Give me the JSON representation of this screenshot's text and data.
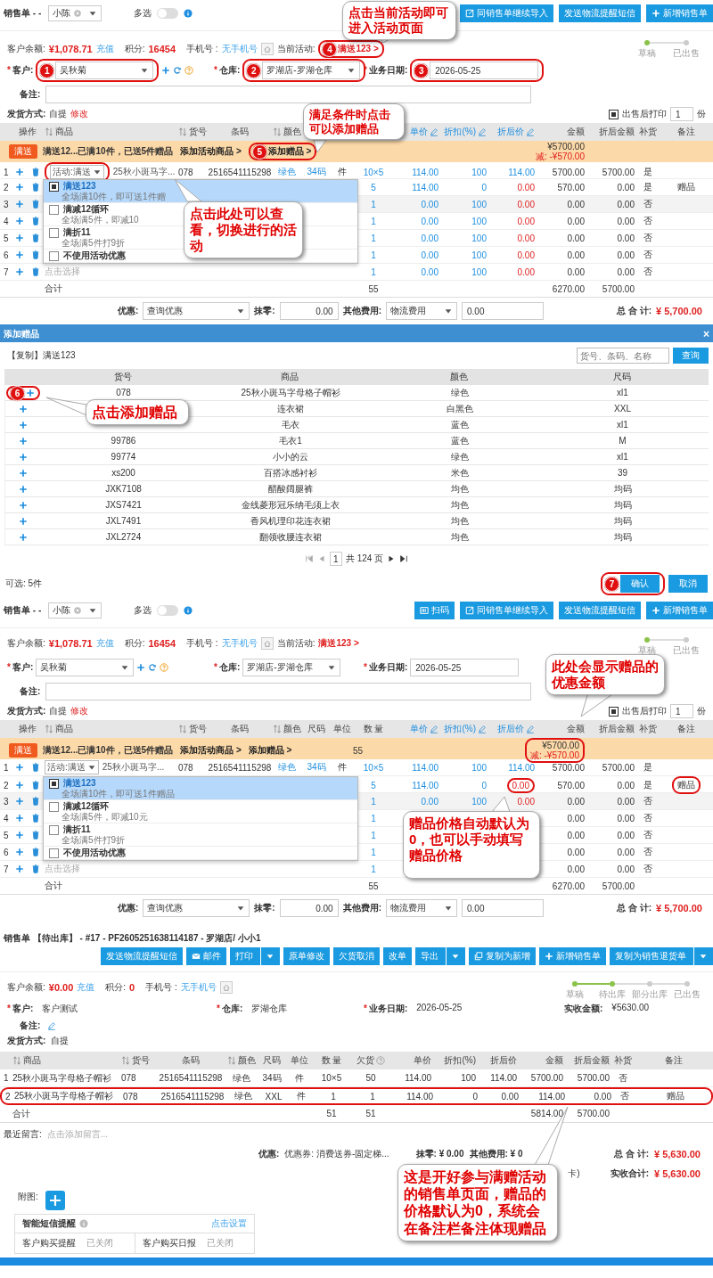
{
  "order_edit_1": {
    "toolbar": {
      "title": "销售单 - -",
      "salesperson": "小陈",
      "multi_select": "多选",
      "multi_select_on": false,
      "buttons": [
        {
          "label": "同销售单继续导入",
          "kind": "import"
        },
        {
          "label": "发送物流提醒短信",
          "kind": "plain"
        },
        {
          "label": "新增销售单",
          "kind": "plus"
        }
      ]
    },
    "info": {
      "balance_label": "客户余额:",
      "balance": "¥1,078.71",
      "recharge": "充值",
      "points_label": "积分:",
      "points": "16454",
      "phone_label": "手机号 :",
      "phone": "无手机号",
      "activity_label": "当前活动:",
      "activity": "满送123 >",
      "activity_marker": "4"
    },
    "steps": [
      {
        "label": "草稿",
        "done": true
      },
      {
        "label": "已出售",
        "done": false
      }
    ],
    "form": [
      {
        "mark": "*",
        "label": "客户:",
        "value": "吴秋菊",
        "kind": "customer",
        "marker": "1"
      },
      {
        "mark": "*",
        "label": "仓库:",
        "value": "罗湖店-罗湖仓库",
        "kind": "select",
        "marker": "2"
      },
      {
        "mark": "*",
        "label": "业务日期:",
        "value": "2026-05-25",
        "kind": "text",
        "marker": "3"
      }
    ],
    "note_label": "备注:",
    "delivery": {
      "label": "发货方式:",
      "value": "自提",
      "action": "修改",
      "print_label": "出售后打印",
      "print_checked": true,
      "copies": "1",
      "copies_unit": "份"
    },
    "columns": [
      {
        "label": "操作",
        "sortable": false,
        "editable": false
      },
      {
        "label": "商品",
        "sortable": true,
        "editable": false
      },
      {
        "label": "货号",
        "sortable": true,
        "editable": false
      },
      {
        "label": "条码",
        "sortable": false,
        "editable": false
      },
      {
        "label": "颜色",
        "sortable": true,
        "editable": false
      },
      {},
      {},
      {},
      {
        "label": "单价",
        "sortable": false,
        "editable": true
      },
      {
        "label": "折扣(%)",
        "sortable": false,
        "editable": true
      },
      {
        "label": "折后价",
        "sortable": false,
        "editable": true
      },
      {
        "label": "金额",
        "sortable": false,
        "editable": false
      },
      {
        "label": "折后金额",
        "sortable": false,
        "editable": false
      },
      {
        "label": "补货",
        "sortable": false,
        "editable": false
      },
      {
        "label": "备注",
        "sortable": false,
        "editable": false
      }
    ],
    "banner": {
      "badge": "满送",
      "text": "满送12...已满10件，已送5件赠品",
      "links": [
        {
          "label": "添加活动商品 >"
        },
        {
          "label": "添加赠品 >",
          "marker": "5"
        }
      ],
      "amount": "¥5700.00",
      "discount": "减: -¥570.00",
      "amount_ringed": false
    },
    "rows": [
      {
        "index": "1",
        "select": "活动:满送",
        "select_ringed": true,
        "hovered": false,
        "zero_price": false,
        "cells": [
          null,
          "25秋小斑马字...",
          "078",
          "2516541115298",
          "绿色",
          "34码",
          "件",
          "10×5",
          "114.00",
          "100",
          "114.00",
          "5700.00",
          "5700.00",
          "是",
          null
        ]
      },
      {
        "index": "2",
        "hovered": false,
        "zero_price": true,
        "cells": [
          null,
          null,
          null,
          null,
          null,
          null,
          null,
          "5",
          "114.00",
          "0",
          "0.00",
          "570.00",
          "0.00",
          "是",
          "赠品"
        ]
      },
      {
        "index": "3",
        "hovered": true,
        "zero_price": true,
        "cells": [
          null,
          null,
          null,
          null,
          null,
          null,
          null,
          "1",
          "0.00",
          "100",
          "0.00",
          "0.00",
          "0.00",
          "否",
          null
        ]
      },
      {
        "index": "4",
        "hovered": false,
        "zero_price": true,
        "cells": [
          null,
          null,
          null,
          null,
          null,
          null,
          null,
          "1",
          "0.00",
          "100",
          "0.00",
          "0.00",
          "0.00",
          "否",
          null
        ]
      },
      {
        "index": "5",
        "hovered": false,
        "zero_price": true,
        "cells": [
          null,
          null,
          null,
          null,
          null,
          null,
          null,
          "1",
          "0.00",
          "100",
          "0.00",
          "0.00",
          "0.00",
          "否",
          null
        ]
      },
      {
        "index": "6",
        "hovered": false,
        "zero_price": true,
        "cells": [
          null,
          null,
          null,
          null,
          null,
          null,
          null,
          "1",
          "0.00",
          "100",
          "0.00",
          "0.00",
          "0.00",
          "否",
          null
        ]
      },
      {
        "index": "7",
        "placeholder": "点击选择",
        "hovered": false,
        "zero_price": true,
        "cells": [
          null,
          null,
          null,
          null,
          null,
          null,
          null,
          "1",
          "0.00",
          "100",
          "0.00",
          "0.00",
          "0.00",
          "否",
          null
        ]
      }
    ],
    "total": {
      "label": "合计",
      "qty": "55",
      "amount": "6270.00",
      "net_amount": "5700.00"
    },
    "dropdown": [
      {
        "title": "满送123",
        "subtitle": "全场满10件，即可送1件赠",
        "checked": true,
        "selected": true
      },
      {
        "title": "满减12循环",
        "subtitle": "全场满5件，即减10",
        "checked": false,
        "selected": false
      },
      {
        "title": "满折11",
        "subtitle": "全场满5件打9折",
        "checked": false,
        "selected": false
      },
      {
        "title": "不使用活动优惠",
        "checked": false,
        "selected": false
      }
    ],
    "footer": {
      "discount_label": "优惠:",
      "discount_select": "查询优惠",
      "rounding_label": "抹零:",
      "rounding": "0.00",
      "other_label": "其他费用:",
      "other_select": "物流费用",
      "other": "0.00",
      "total_label": "总 合 计:",
      "total": "¥ 5,700.00"
    },
    "callouts": [
      {
        "text": "点击当前活动即可进入活动页面"
      },
      {
        "text": "满足条件时点击可以添加赠品"
      },
      {
        "text": "点击此处可以查看，切换进行的活动"
      }
    ]
  },
  "gift_dialog": {
    "title": "添加赠品",
    "close": "×",
    "activity": "【复制】满送123",
    "search_placeholder": "货号、条码、名称",
    "search_button": "查询",
    "columns": [
      "货号",
      "商品",
      "颜色",
      "尺码"
    ],
    "rows": [
      {
        "cells": [
          "078",
          "25秋小斑马字母格子帽衫",
          "绿色",
          "xl1"
        ],
        "marker": "6"
      },
      {
        "cells": [
          null,
          "连衣裙",
          "白黑色",
          "XXL"
        ]
      },
      {
        "cells": [
          null,
          "毛衣",
          "蓝色",
          "xl1"
        ]
      },
      {
        "cells": [
          "99786",
          "毛衣1",
          "蓝色",
          "M"
        ]
      },
      {
        "cells": [
          "99774",
          "小小的云",
          "绿色",
          "xl1"
        ]
      },
      {
        "cells": [
          "xs200",
          "百搭冰感衬衫",
          "米色",
          "39"
        ]
      },
      {
        "cells": [
          "JXK7108",
          "醋酸阔腿裤",
          "均色",
          "均码"
        ]
      },
      {
        "cells": [
          "JXS7421",
          "金线菱形冠乐纳毛须上衣",
          "均色",
          "均码"
        ]
      },
      {
        "cells": [
          "JXL7491",
          "香风机理印花连衣裙",
          "均色",
          "均码"
        ]
      },
      {
        "cells": [
          "JXL2724",
          "翻领收腰连衣裙",
          "均色",
          "均码"
        ]
      }
    ],
    "pagination": {
      "page": "1",
      "summary": "共 124 页"
    },
    "selected_count": "可选: 5件",
    "confirm": {
      "label": "确认",
      "marker": "7"
    },
    "cancel": "取消",
    "callouts": [
      {
        "text": "点击添加赠品"
      }
    ]
  },
  "order_edit_2": {
    "toolbar": {
      "title": "销售单 - -",
      "salesperson": "小陈",
      "multi_select": "多选",
      "multi_select_on": false,
      "buttons": [
        {
          "label": "扫码",
          "kind": "scan"
        },
        {
          "label": "同销售单继续导入",
          "kind": "import"
        },
        {
          "label": "发送物流提醒短信",
          "kind": "plain"
        },
        {
          "label": "新增销售单",
          "kind": "plus"
        }
      ]
    },
    "info": {
      "balance_label": "客户余额:",
      "balance": "¥1,078.71",
      "recharge": "充值",
      "points_label": "积分:",
      "points": "16454",
      "phone_label": "手机号 :",
      "phone": "无手机号",
      "activity_label": "当前活动:",
      "activity": "满送123 >"
    },
    "steps": [
      {
        "label": "草稿",
        "done": true
      },
      {
        "label": "已出售",
        "done": false
      }
    ],
    "form": [
      {
        "mark": "*",
        "label": "客户:",
        "value": "吴秋菊",
        "kind": "customer"
      },
      {
        "mark": "*",
        "label": "仓库:",
        "value": "罗湖店-罗湖仓库",
        "kind": "select"
      },
      {
        "mark": "*",
        "label": "业务日期:",
        "value": "2026-05-25",
        "kind": "text"
      }
    ],
    "note_label": "备注:",
    "delivery": {
      "label": "发货方式:",
      "value": "自提",
      "action": "修改",
      "print_label": "出售后打印",
      "print_checked": true,
      "copies": "1",
      "copies_unit": "份"
    },
    "columns": [
      {
        "label": "操作",
        "sortable": false,
        "editable": false
      },
      {
        "label": "商品",
        "sortable": true,
        "editable": false
      },
      {
        "label": "货号",
        "sortable": true,
        "editable": false
      },
      {
        "label": "条码",
        "sortable": false,
        "editable": false
      },
      {
        "label": "颜色",
        "sortable": true,
        "editable": false
      },
      {
        "label": "尺码",
        "sortable": false,
        "editable": false
      },
      {
        "label": "单位",
        "sortable": false,
        "editable": false
      },
      {
        "label": "数 量",
        "sortable": false,
        "editable": false
      },
      {
        "label": "单价",
        "sortable": false,
        "editable": true
      },
      {
        "label": "折扣(%)",
        "sortable": false,
        "editable": true
      },
      {
        "label": "折后价",
        "sortable": false,
        "editable": true
      },
      {
        "label": "金额",
        "sortable": false,
        "editable": false
      },
      {
        "label": "折后金额",
        "sortable": false,
        "editable": false
      },
      {
        "label": "补货",
        "sortable": false,
        "editable": false
      },
      {
        "label": "备注",
        "sortable": false,
        "editable": false
      }
    ],
    "banner": {
      "badge": "满送",
      "text": "满送12...已满10件，已送5件赠品",
      "links": [
        {
          "label": "添加活动商品 >"
        },
        {
          "label": "添加赠品 >"
        }
      ],
      "qty": "55",
      "amount": "¥5700.00",
      "discount": "减: -¥570.00",
      "amount_ringed": true
    },
    "rows": [
      {
        "index": "1",
        "select": "活动:满送",
        "select_ringed": false,
        "hovered": false,
        "zero_price": false,
        "cells": [
          null,
          "25秋小斑马字...",
          "078",
          "2516541115298",
          "绿色",
          "34码",
          "件",
          "10×5",
          "114.00",
          "100",
          "114.00",
          "5700.00",
          "5700.00",
          "是",
          null
        ]
      },
      {
        "index": "2",
        "hovered": false,
        "zero_price": true,
        "cells": [
          null,
          null,
          null,
          null,
          null,
          null,
          null,
          "5",
          "114.00",
          "0",
          {
            "text": "0.00",
            "ringed": true
          },
          "570.00",
          "0.00",
          "是",
          {
            "text": "赠品",
            "ringed": true
          }
        ]
      },
      {
        "index": "3",
        "hovered": true,
        "zero_price": true,
        "cells": [
          null,
          null,
          null,
          null,
          null,
          null,
          null,
          "1",
          "0.00",
          "100",
          "0.00",
          "0.00",
          "0.00",
          "否",
          null
        ]
      },
      {
        "index": "4",
        "hovered": false,
        "cells": [
          null,
          null,
          null,
          null,
          null,
          null,
          null,
          "1",
          null,
          null,
          null,
          "0.00",
          "0.00",
          "否",
          null
        ]
      },
      {
        "index": "5",
        "hovered": false,
        "cells": [
          null,
          null,
          null,
          null,
          null,
          null,
          null,
          "1",
          null,
          null,
          null,
          "0.00",
          "0.00",
          "否",
          null
        ]
      },
      {
        "index": "6",
        "hovered": false,
        "cells": [
          null,
          null,
          null,
          null,
          null,
          null,
          null,
          "1",
          null,
          null,
          null,
          "0.00",
          "0.00",
          "否",
          null
        ]
      },
      {
        "index": "7",
        "placeholder": "点击选择",
        "hovered": false,
        "cells": [
          null,
          null,
          null,
          null,
          null,
          null,
          null,
          "1",
          null,
          null,
          null,
          "0.00",
          "0.00",
          "否",
          null
        ]
      }
    ],
    "total": {
      "label": "合计",
      "qty": "55",
      "amount": "6270.00",
      "net_amount": "5700.00"
    },
    "dropdown": [
      {
        "title": "满送123",
        "subtitle": "全场满10件，即可送1件赠品",
        "checked": true,
        "selected": true
      },
      {
        "title": "满减12循环",
        "subtitle": "全场满5件，即减10元",
        "checked": false,
        "selected": false
      },
      {
        "title": "满折11",
        "subtitle": "全场满5件打9折",
        "checked": false,
        "selected": false
      },
      {
        "title": "不使用活动优惠",
        "checked": false,
        "selected": false
      }
    ],
    "footer": {
      "discount_label": "优惠:",
      "discount_select": "查询优惠",
      "rounding_label": "抹零:",
      "rounding": "0.00",
      "other_label": "其他费用:",
      "other_select": "物流费用",
      "other": "0.00",
      "total_label": "总 合 计:",
      "total": "¥ 5,700.00"
    },
    "callouts": [
      {
        "text": "此处会显示赠品的优惠金额"
      },
      {
        "text": "赠品价格自动默认为0，也可以手动填写赠品价格"
      }
    ]
  },
  "order_view": {
    "title": "销售单 【待出库】 - #17 - PF2605251638114187 - 罗湖店/ 小小1",
    "buttons": [
      {
        "label": "发送物流提醒短信",
        "kind": "plain",
        "split": false
      },
      {
        "label": "邮件",
        "kind": "mail",
        "split": false
      },
      {
        "label": "打印",
        "kind": "plain",
        "split": true
      },
      {
        "label": "原单修改",
        "kind": "plain",
        "split": false
      },
      {
        "label": "欠货取消",
        "kind": "plain",
        "split": false
      },
      {
        "label": "改单",
        "kind": "plain",
        "split": false
      },
      {
        "label": "导出",
        "kind": "plain",
        "split": true
      },
      {
        "label": "复制为新增",
        "kind": "copy",
        "split": false
      },
      {
        "label": "新增销售单",
        "kind": "plus",
        "split": false
      },
      {
        "label": "复制为销售退货单",
        "kind": "plain",
        "split": true
      }
    ],
    "info": {
      "balance_label": "客户余额:",
      "balance": "¥0.00",
      "recharge": "充值",
      "points_label": "积分:",
      "points": "0",
      "phone_label": "手机号 :",
      "phone": "无手机号"
    },
    "steps": [
      {
        "label": "草稿",
        "done": true
      },
      {
        "label": "待出库",
        "done": true
      },
      {
        "label": "部分出库",
        "done": false
      },
      {
        "label": "已出售",
        "done": false
      }
    ],
    "form": [
      {
        "mark": "*",
        "label": "客户:",
        "value": "客户测试"
      },
      {
        "mark": "*",
        "label": "仓库:",
        "value": "罗湖仓库"
      },
      {
        "mark": "*",
        "label": "业务日期:",
        "value": "2026-05-25"
      },
      {
        "label": "实收金额:",
        "value": "¥5630.00"
      }
    ],
    "note_label": "备注:",
    "delivery": {
      "label": "发货方式:",
      "value": "自提"
    },
    "columns": [
      {
        "label": "商品",
        "sortable": true,
        "help": false
      },
      {
        "label": "货号",
        "sortable": true,
        "help": false
      },
      {
        "label": "条码",
        "sortable": false,
        "help": false
      },
      {
        "label": "颜色",
        "sortable": true,
        "help": false
      },
      {
        "label": "尺码",
        "sortable": false,
        "help": false
      },
      {
        "label": "单位",
        "sortable": false,
        "help": false
      },
      {
        "label": "数 量",
        "sortable": false,
        "help": false
      },
      {
        "label": "欠货",
        "sortable": false,
        "help": true
      },
      {
        "label": "单价",
        "sortable": false,
        "help": false
      },
      {
        "label": "折扣(%)",
        "sortable": false,
        "help": false
      },
      {
        "label": "折后价",
        "sortable": false,
        "help": false
      },
      {
        "label": "金额",
        "sortable": false,
        "help": false
      },
      {
        "label": "折后金额",
        "sortable": false,
        "help": false
      },
      {
        "label": "补货",
        "sortable": false,
        "help": false
      },
      {
        "label": "备注",
        "sortable": false,
        "help": false
      }
    ],
    "rows": [
      {
        "index": "1",
        "ringed": false,
        "cells": [
          "25秋小斑马字母格子帽衫",
          "078",
          "2516541115298",
          "绿色",
          "34码",
          "件",
          "10×5",
          "50",
          "114.00",
          "100",
          "114.00",
          "5700.00",
          "5700.00",
          "否",
          null
        ]
      },
      {
        "index": "2",
        "ringed": true,
        "cells": [
          "25秋小斑马字母格子帽衫",
          "078",
          "2516541115298",
          "绿色",
          "XXL",
          "件",
          "1",
          "1",
          "114.00",
          "0",
          "0.00",
          "114.00",
          "0.00",
          "否",
          "赠品"
        ]
      }
    ],
    "total": {
      "label": "合计",
      "qty": "51",
      "owed": "51",
      "amount": "5814.00",
      "net_amount": "5700.00"
    },
    "message": {
      "label": "最近留言:",
      "placeholder": "点击添加留言..."
    },
    "summary": {
      "discount_label": "优惠:",
      "discount": "优惠券: 消费送券-固定梯...",
      "rounding": "抹零: ¥ 0.00",
      "other": "其他费用: ¥ 0",
      "total_label": "总 合 计:",
      "total": "¥ 5,630.00",
      "fragment": "卡)",
      "received_label": "实收合计:",
      "received": "¥ 5,630.00"
    },
    "attach_label": "附图:",
    "sms": {
      "title": "智能短信提醒",
      "link": "点击设置",
      "items": [
        {
          "label": "客户购买提醒",
          "status": "已关闭"
        },
        {
          "label": "客户购买日报",
          "status": "已关闭"
        }
      ]
    },
    "callouts": [
      {
        "text": "这是开好参与满赠活动的销售单页面，赠品的价格默认为0，系统会在备注栏备注体现赠品"
      }
    ]
  }
}
